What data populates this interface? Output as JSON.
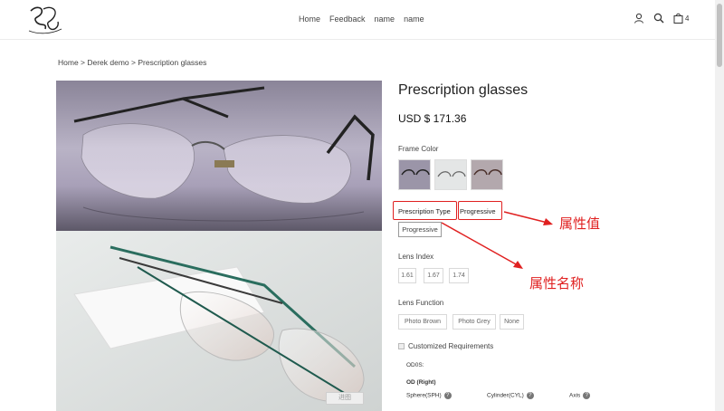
{
  "nav": {
    "items": [
      "Home",
      "Feedback",
      "name",
      "name"
    ]
  },
  "header": {
    "cart_count": "4"
  },
  "breadcrumb": "Home > Derek demo > Prescription glasses",
  "product": {
    "title": "Prescription glasses",
    "price": "USD $ 171.36",
    "image_tag": "进图"
  },
  "frame_color": {
    "label": "Frame Color"
  },
  "prescription": {
    "label": "Prescription Type",
    "value": "Progressive",
    "option": "Progressive"
  },
  "lens_index": {
    "label": "Lens Index",
    "options": [
      "1.61",
      "1.67",
      "1.74"
    ]
  },
  "lens_function": {
    "label": "Lens Function",
    "options": [
      "Photo Brown",
      "Photo Grey",
      "None"
    ]
  },
  "customized": {
    "label": "Customized Requirements",
    "odos": "OD0S:",
    "od_right": "OD (Right)",
    "sphere": "Sphere(SPH)",
    "cylinder": "Cylinder(CYL)",
    "axis": "Axis"
  },
  "annotations": {
    "value": "属性值",
    "name": "属性名称"
  },
  "colors": {
    "accent_red": "#e02020"
  }
}
